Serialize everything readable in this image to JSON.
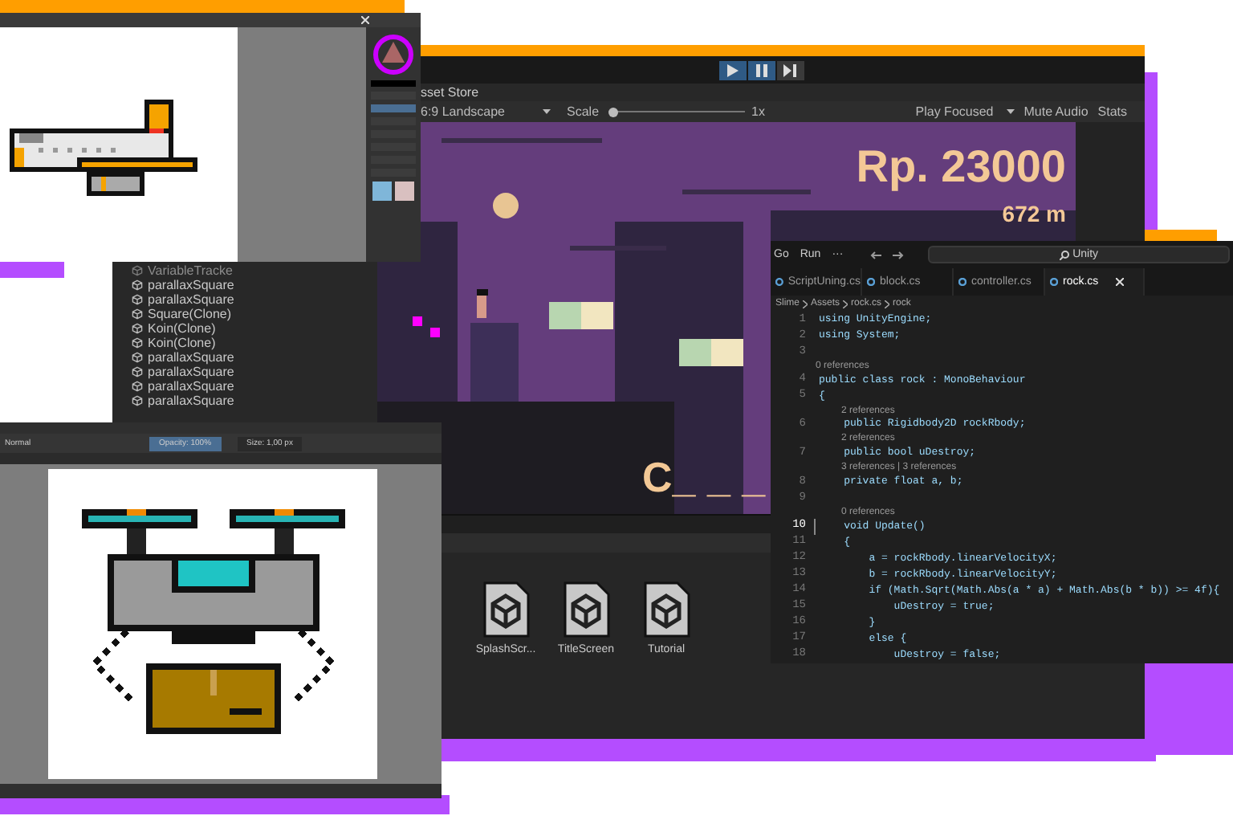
{
  "hierarchy": {
    "items": [
      {
        "name": "VariableTracke",
        "disabled": true
      },
      {
        "name": "parallaxSquare",
        "disabled": false
      },
      {
        "name": "parallaxSquare",
        "disabled": false
      },
      {
        "name": "Square(Clone)",
        "disabled": false
      },
      {
        "name": "Koin(Clone)",
        "disabled": false
      },
      {
        "name": "Koin(Clone)",
        "disabled": false
      },
      {
        "name": "parallaxSquare",
        "disabled": false
      },
      {
        "name": "parallaxSquare",
        "disabled": false
      },
      {
        "name": "parallaxSquare",
        "disabled": false
      },
      {
        "name": "parallaxSquare",
        "disabled": false
      }
    ]
  },
  "unity": {
    "play_controls": [
      {
        "kind": "play",
        "on": true
      },
      {
        "kind": "pause",
        "on": true
      },
      {
        "kind": "step",
        "on": false
      }
    ],
    "tab": "sset Store",
    "aspect": "6:9 Landscape",
    "scale_label": "Scale",
    "scale": {
      "level": 0
    },
    "scale_value": "1x",
    "play_mode": "Play Focused",
    "mute": "Mute Audio",
    "stats": "Stats",
    "game": {
      "money": "Rp. 23000",
      "distance": "672 m",
      "prompt": "C_ _ _"
    },
    "assets": [
      "SplashScr...",
      "TitleScreen",
      "Tutorial"
    ]
  },
  "krita": {
    "blend_mode": "Normal",
    "opacity": "Opacity: 100%",
    "size": "Size: 1,00 px"
  },
  "code_editor": {
    "menu": [
      "Go",
      "Run",
      "···"
    ],
    "search": "Unity",
    "tabs": [
      {
        "label": "ScriptUning.cs",
        "selected": false
      },
      {
        "label": "block.cs",
        "selected": false
      },
      {
        "label": "controller.cs",
        "selected": false
      },
      {
        "label": "rock.cs",
        "selected": true
      }
    ],
    "breadcrumb": [
      "Slime",
      "Assets",
      "rock.cs",
      "rock"
    ],
    "lines": [
      {
        "kind": "line",
        "number": "1",
        "code": "using UnityEngine;",
        "selected": false
      },
      {
        "kind": "line",
        "number": "2",
        "code": "using System;",
        "selected": false
      },
      {
        "kind": "line",
        "number": "3",
        "selected": false
      },
      {
        "kind": "lens",
        "text": "0 references"
      },
      {
        "kind": "line",
        "number": "4",
        "code": "public class rock : MonoBehaviour",
        "selected": false
      },
      {
        "kind": "line",
        "number": "5",
        "code": "{",
        "selected": false
      },
      {
        "kind": "lens",
        "text": "2 references",
        "indent": true
      },
      {
        "kind": "line",
        "number": "6",
        "code": "    public Rigidbody2D rockRbody;",
        "selected": false
      },
      {
        "kind": "lens",
        "text": "2 references",
        "indent": true
      },
      {
        "kind": "line",
        "number": "7",
        "code": "    public bool uDestroy;",
        "selected": false
      },
      {
        "kind": "lens",
        "text": "3 references | 3 references",
        "indent": true
      },
      {
        "kind": "line",
        "number": "8",
        "code": "    private float a, b;",
        "selected": false
      },
      {
        "kind": "line",
        "number": "9",
        "selected": false
      },
      {
        "kind": "lens",
        "text": "0 references",
        "indent": true
      },
      {
        "kind": "line",
        "number": "10",
        "code": "    void Update()",
        "selected": true
      },
      {
        "kind": "line",
        "number": "11",
        "code": "    {",
        "selected": false
      },
      {
        "kind": "line",
        "number": "12",
        "code": "        a = rockRbody.linearVelocityX;",
        "selected": false
      },
      {
        "kind": "line",
        "number": "13",
        "code": "        b = rockRbody.linearVelocityY;",
        "selected": false
      },
      {
        "kind": "line",
        "number": "14",
        "code": "        if (Math.Sqrt(Math.Abs(a * a) + Math.Abs(b * b)) >= 4f){",
        "selected": false
      },
      {
        "kind": "line",
        "number": "15",
        "code": "            uDestroy = true;",
        "selected": false
      },
      {
        "kind": "line",
        "number": "16",
        "code": "        }",
        "selected": false
      },
      {
        "kind": "line",
        "number": "17",
        "code": "        else {",
        "selected": false
      },
      {
        "kind": "line",
        "number": "18",
        "code": "            uDestroy = false;",
        "selected": false
      }
    ]
  }
}
